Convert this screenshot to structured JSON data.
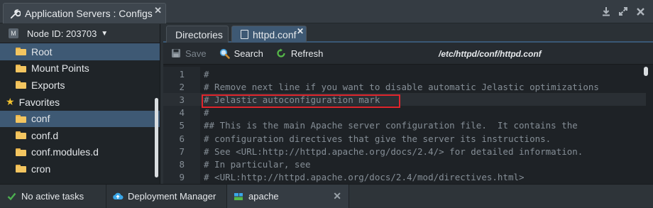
{
  "window": {
    "title": "Application Servers : Configs",
    "close_glyph": "✕"
  },
  "left_panel": {
    "node_label": "Node ID: 203703",
    "node_badge": "M",
    "items": [
      {
        "label": "Root",
        "selected": true
      },
      {
        "label": "Mount Points",
        "selected": false
      },
      {
        "label": "Exports",
        "selected": false
      }
    ],
    "favorites_label": "Favorites",
    "favorites": [
      {
        "label": "conf",
        "selected": true
      },
      {
        "label": "conf.d",
        "selected": false
      },
      {
        "label": "conf.modules.d",
        "selected": false
      },
      {
        "label": "cron",
        "selected": false
      }
    ]
  },
  "tabs": [
    {
      "label": "Directories",
      "active": false
    },
    {
      "label": "httpd.conf",
      "active": true
    }
  ],
  "toolbar": {
    "save_label": "Save",
    "search_label": "Search",
    "refresh_label": "Refresh",
    "file_path": "/etc/httpd/conf/httpd.conf"
  },
  "editor": {
    "highlighted_line": 3,
    "lines": [
      {
        "num": "1",
        "text": "#"
      },
      {
        "num": "2",
        "text": "# Remove next line if you want to disable automatic Jelastic optimizations"
      },
      {
        "num": "3",
        "text": "# Jelastic autoconfiguration mark"
      },
      {
        "num": "4",
        "text": "#"
      },
      {
        "num": "5",
        "text": "## This is the main Apache server configuration file.  It contains the"
      },
      {
        "num": "6",
        "text": "# configuration directives that give the server its instructions."
      },
      {
        "num": "7",
        "text": "# See <URL:http://httpd.apache.org/docs/2.4/> for detailed information."
      },
      {
        "num": "8",
        "text": "# In particular, see"
      },
      {
        "num": "9",
        "text": "# <URL:http://httpd.apache.org/docs/2.4/mod/directives.html>"
      }
    ]
  },
  "statusbar": {
    "tasks_label": "No active tasks",
    "deployment_label": "Deployment Manager",
    "app_label": "apache"
  },
  "colors": {
    "accent": "#3e5974",
    "highlight_box": "#e0262d",
    "folder": "#f3c560",
    "favorite_star": "#f2c230",
    "success_check": "#4caf50"
  },
  "icons": [
    "wrench-icon",
    "download-icon",
    "expand-icon",
    "close-icon",
    "folder-icon",
    "star-icon",
    "file-icon",
    "save-icon",
    "search-icon",
    "refresh-icon",
    "check-icon",
    "cloud-icon",
    "stack-icon"
  ]
}
